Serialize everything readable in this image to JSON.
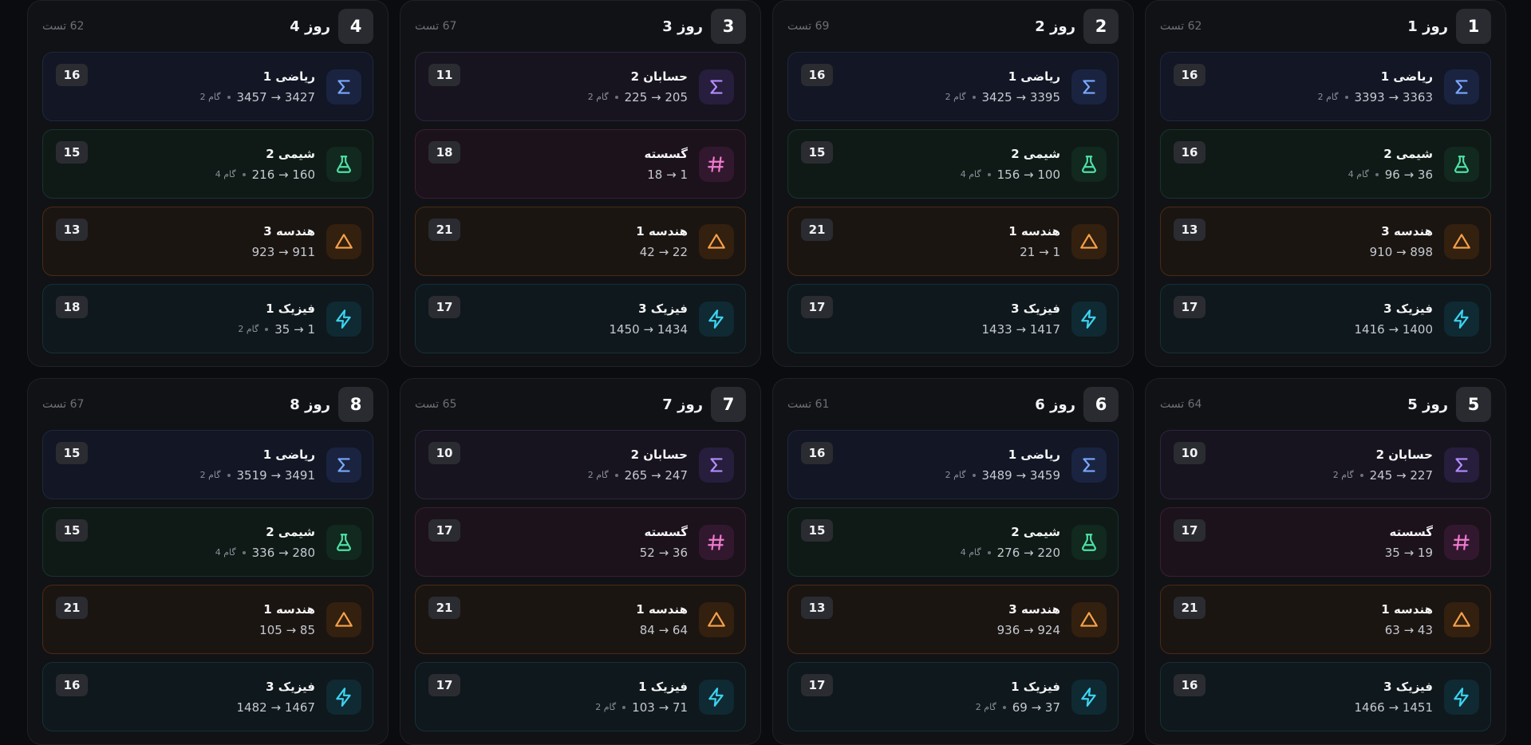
{
  "days": [
    {
      "num": "1",
      "title": "روز 1",
      "count": "62 تست",
      "cards": [
        {
          "type": "math",
          "icon": "sigma-icon",
          "subject": "ریاضی 1",
          "range": "3363 → 3393",
          "step": "گام 2",
          "badge": "16"
        },
        {
          "type": "chem",
          "icon": "flask-icon",
          "subject": "شیمی 2",
          "range": "36 → 96",
          "step": "گام 4",
          "badge": "16"
        },
        {
          "type": "geo",
          "icon": "triangle-icon",
          "subject": "هندسه 3",
          "range": "898 → 910",
          "step": "",
          "badge": "13"
        },
        {
          "type": "phys",
          "icon": "bolt-icon",
          "subject": "فیزیک 3",
          "range": "1400 → 1416",
          "step": "",
          "badge": "17"
        }
      ]
    },
    {
      "num": "2",
      "title": "روز 2",
      "count": "69 تست",
      "cards": [
        {
          "type": "math",
          "icon": "sigma-icon",
          "subject": "ریاضی 1",
          "range": "3395 → 3425",
          "step": "گام 2",
          "badge": "16"
        },
        {
          "type": "chem",
          "icon": "flask-icon",
          "subject": "شیمی 2",
          "range": "100 → 156",
          "step": "گام 4",
          "badge": "15"
        },
        {
          "type": "geo",
          "icon": "triangle-icon",
          "subject": "هندسه 1",
          "range": "1 → 21",
          "step": "",
          "badge": "21"
        },
        {
          "type": "phys",
          "icon": "bolt-icon",
          "subject": "فیزیک 3",
          "range": "1417 → 1433",
          "step": "",
          "badge": "17"
        }
      ]
    },
    {
      "num": "3",
      "title": "روز 3",
      "count": "67 تست",
      "cards": [
        {
          "type": "calc",
          "icon": "sigma-icon",
          "subject": "حسابان 2",
          "range": "205 → 225",
          "step": "گام 2",
          "badge": "11"
        },
        {
          "type": "disc",
          "icon": "hash-icon",
          "subject": "گسسته",
          "range": "1 → 18",
          "step": "",
          "badge": "18"
        },
        {
          "type": "geo",
          "icon": "triangle-icon",
          "subject": "هندسه 1",
          "range": "22 → 42",
          "step": "",
          "badge": "21"
        },
        {
          "type": "phys",
          "icon": "bolt-icon",
          "subject": "فیزیک 3",
          "range": "1434 → 1450",
          "step": "",
          "badge": "17"
        }
      ]
    },
    {
      "num": "4",
      "title": "روز 4",
      "count": "62 تست",
      "cards": [
        {
          "type": "math",
          "icon": "sigma-icon",
          "subject": "ریاضی 1",
          "range": "3427 → 3457",
          "step": "گام 2",
          "badge": "16"
        },
        {
          "type": "chem",
          "icon": "flask-icon",
          "subject": "شیمی 2",
          "range": "160 → 216",
          "step": "گام 4",
          "badge": "15"
        },
        {
          "type": "geo",
          "icon": "triangle-icon",
          "subject": "هندسه 3",
          "range": "911 → 923",
          "step": "",
          "badge": "13"
        },
        {
          "type": "phys",
          "icon": "bolt-icon",
          "subject": "فیزیک 1",
          "range": "1 → 35",
          "step": "گام 2",
          "badge": "18"
        }
      ]
    },
    {
      "num": "5",
      "title": "روز 5",
      "count": "64 تست",
      "cards": [
        {
          "type": "calc",
          "icon": "sigma-icon",
          "subject": "حسابان 2",
          "range": "227 → 245",
          "step": "گام 2",
          "badge": "10"
        },
        {
          "type": "disc",
          "icon": "hash-icon",
          "subject": "گسسته",
          "range": "19 → 35",
          "step": "",
          "badge": "17"
        },
        {
          "type": "geo",
          "icon": "triangle-icon",
          "subject": "هندسه 1",
          "range": "43 → 63",
          "step": "",
          "badge": "21"
        },
        {
          "type": "phys",
          "icon": "bolt-icon",
          "subject": "فیزیک 3",
          "range": "1451 → 1466",
          "step": "",
          "badge": "16"
        }
      ]
    },
    {
      "num": "6",
      "title": "روز 6",
      "count": "61 تست",
      "cards": [
        {
          "type": "math",
          "icon": "sigma-icon",
          "subject": "ریاضی 1",
          "range": "3459 → 3489",
          "step": "گام 2",
          "badge": "16"
        },
        {
          "type": "chem",
          "icon": "flask-icon",
          "subject": "شیمی 2",
          "range": "220 → 276",
          "step": "گام 4",
          "badge": "15"
        },
        {
          "type": "geo",
          "icon": "triangle-icon",
          "subject": "هندسه 3",
          "range": "924 → 936",
          "step": "",
          "badge": "13"
        },
        {
          "type": "phys",
          "icon": "bolt-icon",
          "subject": "فیزیک 1",
          "range": "37 → 69",
          "step": "گام 2",
          "badge": "17"
        }
      ]
    },
    {
      "num": "7",
      "title": "روز 7",
      "count": "65 تست",
      "cards": [
        {
          "type": "calc",
          "icon": "sigma-icon",
          "subject": "حسابان 2",
          "range": "247 → 265",
          "step": "گام 2",
          "badge": "10"
        },
        {
          "type": "disc",
          "icon": "hash-icon",
          "subject": "گسسته",
          "range": "36 → 52",
          "step": "",
          "badge": "17"
        },
        {
          "type": "geo",
          "icon": "triangle-icon",
          "subject": "هندسه 1",
          "range": "64 → 84",
          "step": "",
          "badge": "21"
        },
        {
          "type": "phys",
          "icon": "bolt-icon",
          "subject": "فیزیک 1",
          "range": "71 → 103",
          "step": "گام 2",
          "badge": "17"
        }
      ]
    },
    {
      "num": "8",
      "title": "روز 8",
      "count": "67 تست",
      "cards": [
        {
          "type": "math",
          "icon": "sigma-icon",
          "subject": "ریاضی 1",
          "range": "3491 → 3519",
          "step": "گام 2",
          "badge": "15"
        },
        {
          "type": "chem",
          "icon": "flask-icon",
          "subject": "شیمی 2",
          "range": "280 → 336",
          "step": "گام 4",
          "badge": "15"
        },
        {
          "type": "geo",
          "icon": "triangle-icon",
          "subject": "هندسه 1",
          "range": "85 → 105",
          "step": "",
          "badge": "21"
        },
        {
          "type": "phys",
          "icon": "bolt-icon",
          "subject": "فیزیک 3",
          "range": "1467 → 1482",
          "step": "",
          "badge": "16"
        }
      ]
    }
  ]
}
